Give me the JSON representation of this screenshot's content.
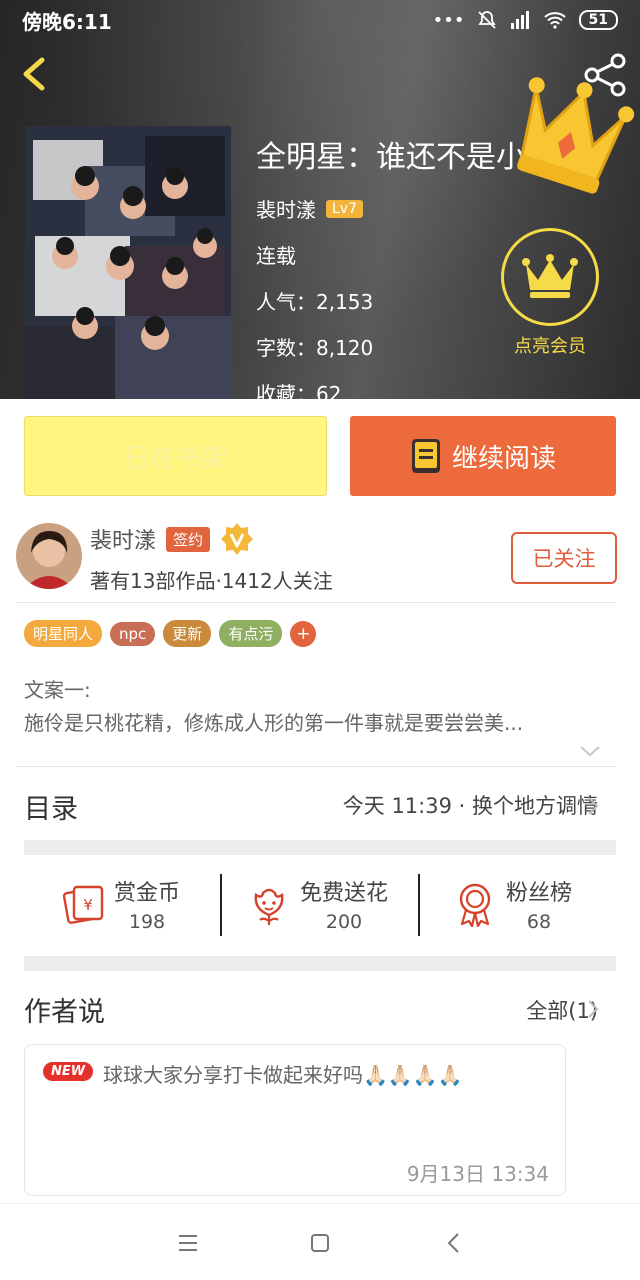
{
  "status_bar": {
    "time": "傍晚6:11",
    "battery": "51"
  },
  "book": {
    "title": "全明星：谁还不是小",
    "author": "裴时漾",
    "level": "Lv7",
    "status": "连载",
    "popularity": "人气：2,153",
    "word_count": "字数：8,120",
    "favorites": "收藏：62"
  },
  "vip": {
    "label": "点亮会员"
  },
  "buttons": {
    "shelf": "已在书架",
    "read": "继续阅读"
  },
  "author_block": {
    "name": "裴时漾",
    "badge": "签约",
    "meta": "著有13部作品·1412人关注",
    "follow": "已关注"
  },
  "tags": [
    {
      "label": "明星同人",
      "color": "#f3a93c"
    },
    {
      "label": "npc",
      "color": "#c86e55"
    },
    {
      "label": "更新",
      "color": "#c98a3b"
    },
    {
      "label": "有点污",
      "color": "#8fb061"
    }
  ],
  "tag_plus": "+",
  "synopsis": {
    "line1": "文案一:",
    "line2": "施伶是只桃花精，修炼成人形的第一件事就是要尝尝美..."
  },
  "catalog": {
    "title": "目录",
    "latest": "今天 11:39 · 换个地方调情"
  },
  "stats": [
    {
      "label": "赏金币",
      "value": "198",
      "icon": "red-envelope-icon"
    },
    {
      "label": "免费送花",
      "value": "200",
      "icon": "flower-icon"
    },
    {
      "label": "粉丝榜",
      "value": "68",
      "icon": "medal-icon"
    }
  ],
  "author_says": {
    "title": "作者说",
    "all": "全部(1)",
    "badge": "NEW",
    "text": "球球大家分享打卡做起来好吗🙏🏻🙏🏻🙏🏻🙏🏻",
    "date": "9月13日  13:34"
  },
  "colors": {
    "accent": "#ec6a3c",
    "vip_gold": "#f5db48",
    "shelf_yellow": "#fff57f"
  }
}
